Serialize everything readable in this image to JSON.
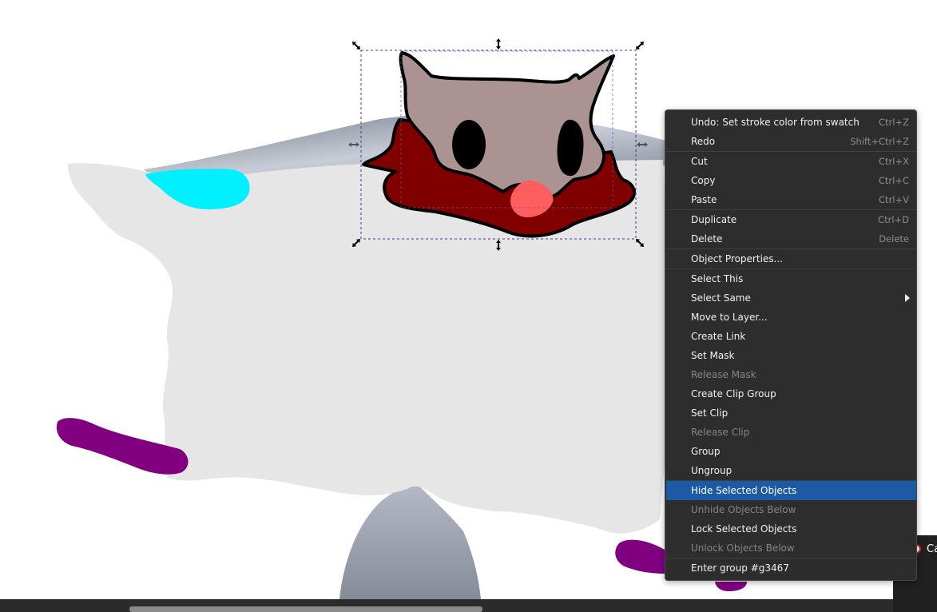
{
  "context_menu": {
    "items": [
      {
        "label": "Undo: Set stroke color from swatch",
        "shortcut": "Ctrl+Z"
      },
      {
        "label": "Redo",
        "shortcut": "Shift+Ctrl+Z"
      },
      {
        "label": "Cut",
        "shortcut": "Ctrl+X"
      },
      {
        "label": "Copy",
        "shortcut": "Ctrl+C"
      },
      {
        "label": "Paste",
        "shortcut": "Ctrl+V"
      },
      {
        "label": "Duplicate",
        "shortcut": "Ctrl+D"
      },
      {
        "label": "Delete",
        "shortcut": "Delete"
      },
      {
        "label": "Object Properties..."
      },
      {
        "label": "Select This"
      },
      {
        "label": "Select Same",
        "submenu": true
      },
      {
        "label": "Move to Layer..."
      },
      {
        "label": "Create Link"
      },
      {
        "label": "Set Mask"
      },
      {
        "label": "Release Mask",
        "disabled": true
      },
      {
        "label": "Create Clip Group"
      },
      {
        "label": "Set Clip"
      },
      {
        "label": "Release Clip",
        "disabled": true
      },
      {
        "label": "Group"
      },
      {
        "label": "Ungroup"
      },
      {
        "label": "Hide Selected Objects",
        "highlighted": true
      },
      {
        "label": "Unhide Objects Below",
        "disabled": true
      },
      {
        "label": "Lock Selected Objects"
      },
      {
        "label": "Unlock Objects Below",
        "disabled": true
      },
      {
        "label": "Enter group #g3467"
      }
    ]
  },
  "side_panel": {
    "text": "Ca"
  },
  "colors": {
    "menu_bg": "#2d2d2d",
    "highlight": "#1d5aa3",
    "map_fill": "#e6e6e6",
    "cyan_shape": "#00f0ff",
    "purple_shape": "#800080",
    "owl_face": "#ac9393",
    "owl_ruff": "#800000",
    "owl_beak": "#ff5e5e"
  },
  "icons": {
    "scale_handle": "double-arrow-icon",
    "submenu": "chevron-right-icon"
  }
}
